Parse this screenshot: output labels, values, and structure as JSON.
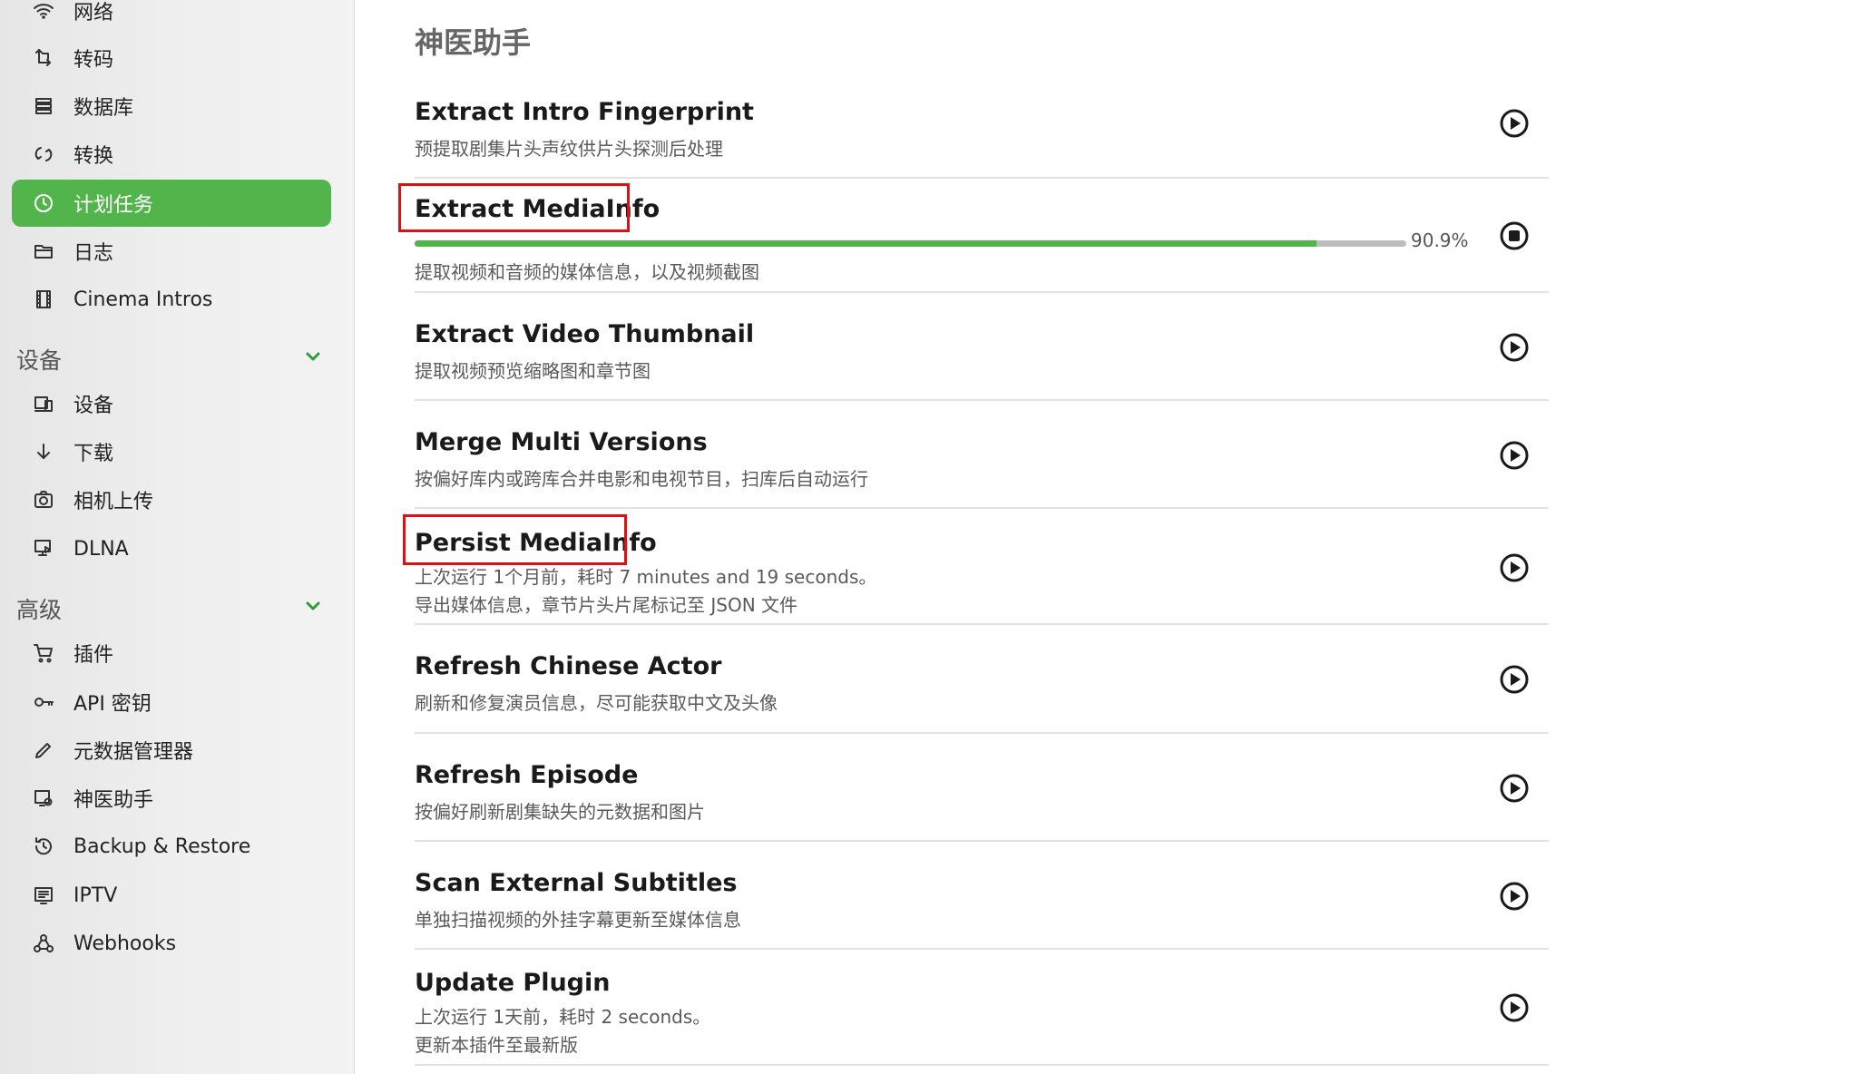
{
  "sidebar": {
    "items_top": [
      {
        "label": "网络",
        "icon": "wifi-icon"
      },
      {
        "label": "转码",
        "icon": "transcode-icon"
      },
      {
        "label": "数据库",
        "icon": "database-icon"
      },
      {
        "label": "转换",
        "icon": "convert-icon"
      },
      {
        "label": "计划任务",
        "icon": "clock-icon",
        "active": true
      },
      {
        "label": "日志",
        "icon": "folder-icon"
      },
      {
        "label": "Cinema Intros",
        "icon": "film-icon"
      }
    ],
    "devices_header": "设备",
    "items_devices": [
      {
        "label": "设备",
        "icon": "devices-icon"
      },
      {
        "label": "下载",
        "icon": "download-icon"
      },
      {
        "label": "相机上传",
        "icon": "camera-icon"
      },
      {
        "label": "DLNA",
        "icon": "dlna-icon"
      }
    ],
    "advanced_header": "高级",
    "items_advanced": [
      {
        "label": "插件",
        "icon": "cart-icon"
      },
      {
        "label": "API 密钥",
        "icon": "key-icon"
      },
      {
        "label": "元数据管理器",
        "icon": "pencil-icon"
      },
      {
        "label": "神医助手",
        "icon": "assistant-icon"
      },
      {
        "label": "Backup & Restore",
        "icon": "history-icon"
      },
      {
        "label": "IPTV",
        "icon": "tv-list-icon"
      },
      {
        "label": "Webhooks",
        "icon": "webhooks-icon"
      }
    ]
  },
  "main": {
    "title": "神医助手",
    "tasks": [
      {
        "name": "Extract Intro Fingerprint",
        "desc": "预提取剧集片头声纹供片头探测后处理",
        "action": "play"
      },
      {
        "name": "Extract MediaInfo",
        "desc": "提取视频和音频的媒体信息，以及视频截图",
        "action": "stop",
        "progress": 90.9,
        "progress_label": "90.9%"
      },
      {
        "name": "Extract Video Thumbnail",
        "desc": "提取视频预览缩略图和章节图",
        "action": "play"
      },
      {
        "name": "Merge Multi Versions",
        "desc": "按偏好库内或跨库合并电影和电视节目，扫库后自动运行",
        "action": "play"
      },
      {
        "name": "Persist MediaInfo",
        "status": "上次运行 1个月前，耗时 7 minutes and 19 seconds。",
        "desc": "导出媒体信息，章节片头片尾标记至 JSON 文件",
        "action": "play"
      },
      {
        "name": "Refresh Chinese Actor",
        "desc": "刷新和修复演员信息，尽可能获取中文及头像",
        "action": "play"
      },
      {
        "name": "Refresh Episode",
        "desc": "按偏好刷新剧集缺失的元数据和图片",
        "action": "play"
      },
      {
        "name": "Scan External Subtitles",
        "desc": "单独扫描视频的外挂字幕更新至媒体信息",
        "action": "play"
      },
      {
        "name": "Update Plugin",
        "status": "上次运行 1天前，耗时 2 seconds。",
        "desc": "更新本插件至最新版",
        "action": "play"
      }
    ]
  },
  "colors": {
    "accent": "#52b54b",
    "highlight": "#e01010"
  }
}
